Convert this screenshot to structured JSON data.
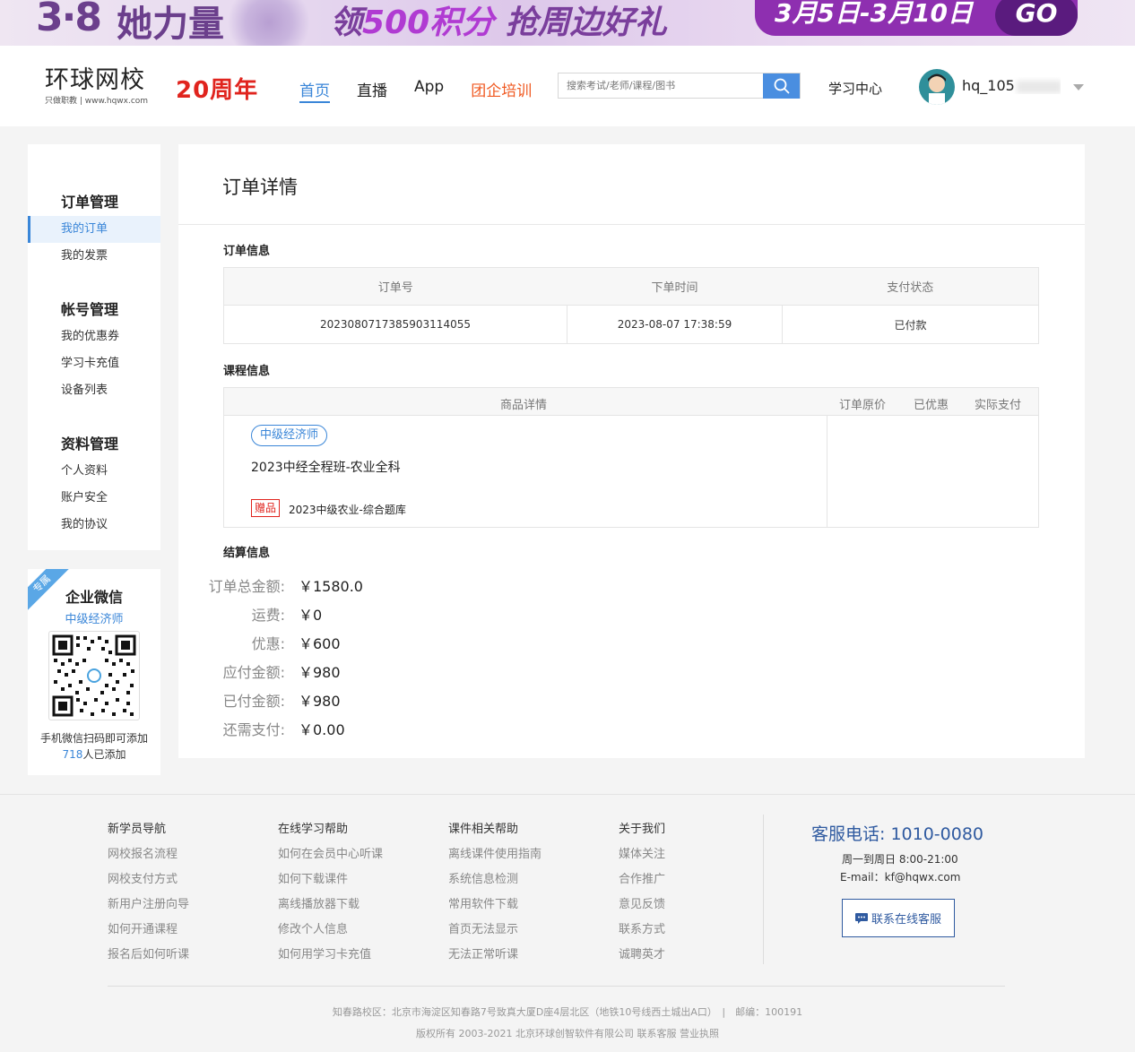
{
  "banner": {
    "brand": "3·8",
    "slogan": "她力量",
    "main_prefix": "领",
    "main_highlight": "500积分",
    "main_suffix": " 抢周边好礼",
    "date": "3月5日-3月10日",
    "go": "GO"
  },
  "header": {
    "logo_text": "环球网校",
    "logo_sub": "只做职教 | www.hqwx.com",
    "anniversary": "20周年",
    "nav": [
      {
        "label": "首页",
        "active": true
      },
      {
        "label": "直播"
      },
      {
        "label": "App"
      },
      {
        "label": "团企培训",
        "highlight": true
      }
    ],
    "search_placeholder": "搜索考试/老师/课程/图书",
    "learning_center": "学习中心",
    "username": "hq_105"
  },
  "sidebar": {
    "groups": [
      {
        "title": "订单管理",
        "items": [
          "我的订单",
          "我的发票"
        ]
      },
      {
        "title": "帐号管理",
        "items": [
          "我的优惠券",
          "学习卡充值",
          "设备列表"
        ]
      },
      {
        "title": "资料管理",
        "items": [
          "个人资料",
          "账户安全",
          "我的协议"
        ]
      }
    ],
    "active_item": "我的订单"
  },
  "wechat": {
    "ribbon": "专属",
    "title": "企业微信",
    "subject": "中级经济师",
    "note": "手机微信扫码即可添加",
    "count": "718",
    "count_suffix": "人已添加"
  },
  "main": {
    "title": "订单详情",
    "order_section": "订单信息",
    "order_headers": [
      "订单号",
      "下单时间",
      "支付状态"
    ],
    "order_row": [
      "20230807173859031140​55",
      "2023-08-07 17:38:59",
      "已付款"
    ],
    "course_section": "课程信息",
    "course_headers": [
      "商品详情",
      "订单原价",
      "已优惠",
      "实际支付"
    ],
    "course_tag": "中级经济师",
    "course_name": "2023中经全程班-农业全科",
    "gift_tag": "赠品",
    "gift_name": "2023中级农业-综合题库",
    "settle_section": "结算信息",
    "settlement": [
      {
        "label": "订单总金额:",
        "value": "￥1580.0"
      },
      {
        "label": "运费:",
        "value": "￥0"
      },
      {
        "label": "优惠:",
        "value": "￥600"
      },
      {
        "label": "应付金额:",
        "value": "￥980"
      },
      {
        "label": "已付金额:",
        "value": "￥980"
      },
      {
        "label": "还需支付:",
        "value": "￥0.00"
      }
    ]
  },
  "footer": {
    "columns": [
      {
        "title": "新学员导航",
        "links": [
          "网校报名流程",
          "网校支付方式",
          "新用户注册向导",
          "如何开通课程",
          "报名后如何听课"
        ]
      },
      {
        "title": "在线学习帮助",
        "links": [
          "如何在会员中心听课",
          "如何下载课件",
          "离线播放器下载",
          "修改个人信息",
          "如何用学习卡充值"
        ]
      },
      {
        "title": "课件相关帮助",
        "links": [
          "离线课件使用指南",
          "系统信息检测",
          "常用软件下载",
          "首页无法显示",
          "无法正常听课"
        ]
      },
      {
        "title": "关于我们",
        "links": [
          "媒体关注",
          "合作推广",
          "意见反馈",
          "联系方式",
          "诚聘英才"
        ]
      }
    ],
    "phone": "客服电话: 1010-0080",
    "hours": "周一到周日 8:00-21:00",
    "email": "E-mail：kf@hqwx.com",
    "online_service": "联系在线客服",
    "address": "知春路校区：北京市海淀区知春路7号致真大厦D座4层北区（地铁10号线西土城出A口）　|　邮编：100191",
    "copyright": "版权所有 2003-2021 北京环球创智软件有限公司 联系客服 营业执照"
  }
}
